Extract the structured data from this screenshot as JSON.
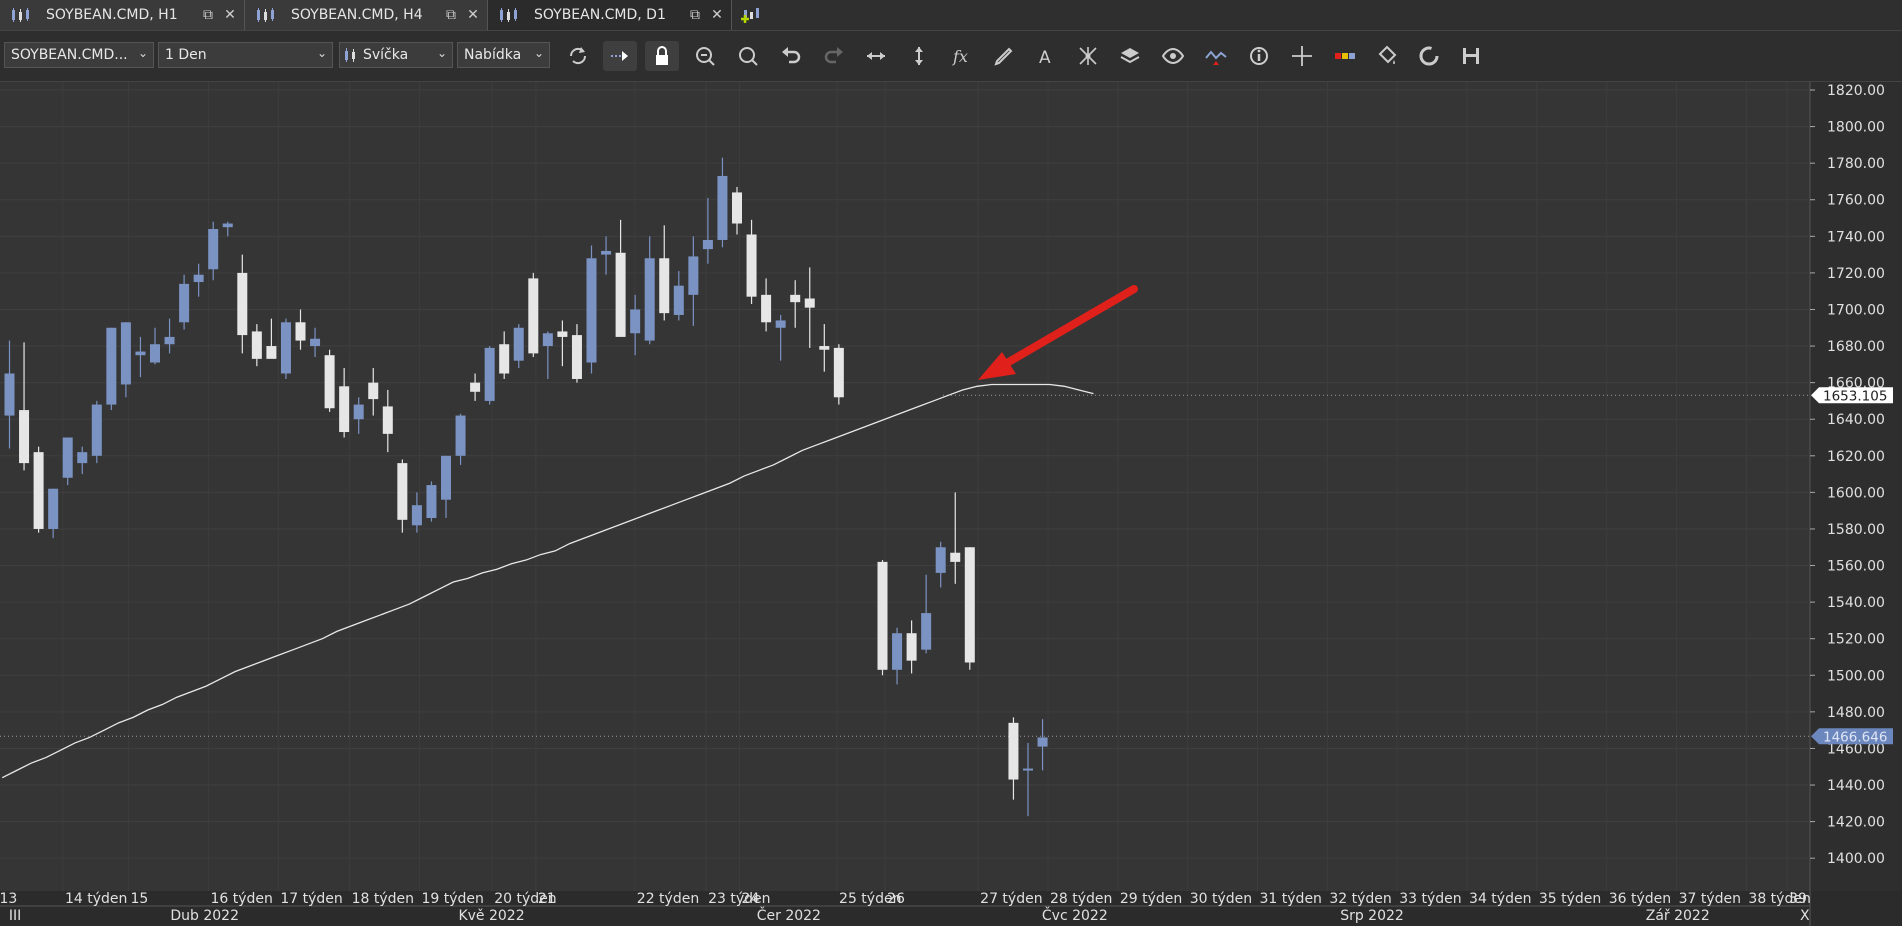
{
  "tabs": [
    {
      "label": "SOYBEAN.CMD, H1",
      "active": false
    },
    {
      "label": "SOYBEAN.CMD, H4",
      "active": false
    },
    {
      "label": "SOYBEAN.CMD, D1",
      "active": true
    }
  ],
  "toolbar": {
    "symbol": "SOYBEAN.CMD...",
    "timeframe": "1 Den",
    "chart_type": "Svíčka",
    "price_side": "Nabídka",
    "icons": [
      "refresh-icon",
      "shift-icon",
      "lock-icon",
      "zoom-in-icon",
      "zoom-out-icon",
      "undo-icon",
      "redo-icon",
      "horizontal-scale-icon",
      "vertical-scale-icon",
      "indicators-icon",
      "pencil-icon",
      "text-icon",
      "pattern-icon",
      "layers-icon",
      "eye-icon",
      "signals-icon",
      "info-icon",
      "crosshair-icon",
      "gauge-icon",
      "paint-icon",
      "reset-icon",
      "save-icon"
    ]
  },
  "colors": {
    "background": "#353535",
    "bull": "#7b93c3",
    "bear": "#e6e6e6",
    "ma_line": "#e8e8e8",
    "arrow": "#e0201b",
    "current_price_label": "#6c87bd"
  },
  "chart_data": {
    "type": "candlestick",
    "y_axis": {
      "min": 1390,
      "max": 1830,
      "ticks": [
        "1820.00",
        "1800.00",
        "1780.00",
        "1760.00",
        "1740.00",
        "1720.00",
        "1700.00",
        "1680.00",
        "1660.00",
        "1640.00",
        "1620.00",
        "1600.00",
        "1580.00",
        "1560.00",
        "1540.00",
        "1520.00",
        "1500.00",
        "1480.00",
        "1460.00",
        "1440.00",
        "1420.00",
        "1400.00"
      ],
      "tick_values": [
        1820,
        1800,
        1780,
        1760,
        1740,
        1720,
        1700,
        1680,
        1660,
        1640,
        1620,
        1600,
        1580,
        1560,
        1540,
        1520,
        1500,
        1480,
        1460,
        1440,
        1420,
        1400
      ]
    },
    "price_labels": [
      {
        "text": "1653.105",
        "value": 1653.105
      },
      {
        "text": "1466.646",
        "value": 1466.646
      }
    ],
    "week_labels": [
      {
        "text": "13",
        "bar": 0
      },
      {
        "text": "14 týden",
        "bar": 4.5
      },
      {
        "text": "15",
        "bar": 9
      },
      {
        "text": "16 týden",
        "bar": 14.5
      },
      {
        "text": "17 týden",
        "bar": 19.3
      },
      {
        "text": "18 týden",
        "bar": 24.2
      },
      {
        "text": "19 týden",
        "bar": 29
      },
      {
        "text": "20 týden",
        "bar": 34
      },
      {
        "text": "21",
        "bar": 37
      },
      {
        "text": "22 týden",
        "bar": 43.8
      },
      {
        "text": "23 týden",
        "bar": 48.7
      },
      {
        "text": "24",
        "bar": 51
      },
      {
        "text": "25 týden",
        "bar": 57.7
      },
      {
        "text": "26",
        "bar": 61
      },
      {
        "text": "27 týden",
        "bar": 67.4
      },
      {
        "text": "28 týden",
        "bar": 72.2
      },
      {
        "text": "29 týden",
        "bar": 77
      },
      {
        "text": "30 týden",
        "bar": 81.8
      },
      {
        "text": "31 týden",
        "bar": 86.6
      },
      {
        "text": "32 týden",
        "bar": 91.4
      },
      {
        "text": "33 týden",
        "bar": 96.2
      },
      {
        "text": "34 týden",
        "bar": 101
      },
      {
        "text": "35 týden",
        "bar": 105.8
      },
      {
        "text": "36 týden",
        "bar": 110.6
      },
      {
        "text": "37 týden",
        "bar": 115.4
      },
      {
        "text": "38 týden",
        "bar": 120.2
      },
      {
        "text": "39",
        "bar": 123
      }
    ],
    "month_labels": [
      {
        "text": "III",
        "bar": 0.3
      },
      {
        "text": "Dub 2022",
        "bar": 11.4
      },
      {
        "text": "Kvě 2022",
        "bar": 31.2
      },
      {
        "text": "Čer 2022",
        "bar": 51.7
      },
      {
        "text": "Čvc 2022",
        "bar": 71.3
      },
      {
        "text": "Srp 2022",
        "bar": 91.8
      },
      {
        "text": "Zář 2022",
        "bar": 112.8
      },
      {
        "text": "X",
        "bar": 123.4
      }
    ],
    "candles": [
      {
        "o": 1642,
        "h": 1683,
        "l": 1624,
        "c": 1665
      },
      {
        "o": 1645,
        "h": 1682,
        "l": 1612,
        "c": 1616
      },
      {
        "o": 1622,
        "h": 1625,
        "l": 1578,
        "c": 1580
      },
      {
        "o": 1580,
        "h": 1602,
        "l": 1575,
        "c": 1602
      },
      {
        "o": 1608,
        "h": 1630,
        "l": 1604,
        "c": 1630
      },
      {
        "o": 1616,
        "h": 1625,
        "l": 1610,
        "c": 1622
      },
      {
        "o": 1620,
        "h": 1650,
        "l": 1616,
        "c": 1648
      },
      {
        "o": 1648,
        "h": 1690,
        "l": 1645,
        "c": 1690
      },
      {
        "o": 1659,
        "h": 1693,
        "l": 1652,
        "c": 1693
      },
      {
        "o": 1675,
        "h": 1685,
        "l": 1663,
        "c": 1677
      },
      {
        "o": 1671,
        "h": 1690,
        "l": 1670,
        "c": 1681
      },
      {
        "o": 1681,
        "h": 1695,
        "l": 1676,
        "c": 1685
      },
      {
        "o": 1693,
        "h": 1719,
        "l": 1689,
        "c": 1714
      },
      {
        "o": 1715,
        "h": 1725,
        "l": 1707,
        "c": 1719
      },
      {
        "o": 1722,
        "h": 1748,
        "l": 1716,
        "c": 1744
      },
      {
        "o": 1745,
        "h": 1748,
        "l": 1740,
        "c": 1747
      },
      {
        "o": 1720,
        "h": 1730,
        "l": 1676,
        "c": 1686
      },
      {
        "o": 1688,
        "h": 1692,
        "l": 1669,
        "c": 1673
      },
      {
        "o": 1680,
        "h": 1695,
        "l": 1675,
        "c": 1673
      },
      {
        "o": 1665,
        "h": 1695,
        "l": 1662,
        "c": 1693
      },
      {
        "o": 1693,
        "h": 1700,
        "l": 1678,
        "c": 1683
      },
      {
        "o": 1680,
        "h": 1690,
        "l": 1674,
        "c": 1684
      },
      {
        "o": 1675,
        "h": 1678,
        "l": 1644,
        "c": 1646
      },
      {
        "o": 1658,
        "h": 1668,
        "l": 1630,
        "c": 1633
      },
      {
        "o": 1640,
        "h": 1652,
        "l": 1632,
        "c": 1648
      },
      {
        "o": 1660,
        "h": 1668,
        "l": 1642,
        "c": 1651
      },
      {
        "o": 1647,
        "h": 1656,
        "l": 1622,
        "c": 1632
      },
      {
        "o": 1616,
        "h": 1618,
        "l": 1578,
        "c": 1585
      },
      {
        "o": 1582,
        "h": 1600,
        "l": 1578,
        "c": 1593
      },
      {
        "o": 1586,
        "h": 1606,
        "l": 1584,
        "c": 1604
      },
      {
        "o": 1596,
        "h": 1620,
        "l": 1586,
        "c": 1620
      },
      {
        "o": 1620,
        "h": 1643,
        "l": 1615,
        "c": 1642
      },
      {
        "o": 1660,
        "h": 1665,
        "l": 1650,
        "c": 1655
      },
      {
        "o": 1650,
        "h": 1680,
        "l": 1648,
        "c": 1679
      },
      {
        "o": 1681,
        "h": 1688,
        "l": 1662,
        "c": 1665
      },
      {
        "o": 1672,
        "h": 1692,
        "l": 1668,
        "c": 1690
      },
      {
        "o": 1717,
        "h": 1720,
        "l": 1674,
        "c": 1676
      },
      {
        "o": 1680,
        "h": 1688,
        "l": 1662,
        "c": 1687
      },
      {
        "o": 1688,
        "h": 1694,
        "l": 1669,
        "c": 1685
      },
      {
        "o": 1686,
        "h": 1692,
        "l": 1660,
        "c": 1662
      },
      {
        "o": 1671,
        "h": 1735,
        "l": 1665,
        "c": 1728
      },
      {
        "o": 1730,
        "h": 1740,
        "l": 1719,
        "c": 1732
      },
      {
        "o": 1731,
        "h": 1749,
        "l": 1692,
        "c": 1685
      },
      {
        "o": 1687,
        "h": 1708,
        "l": 1675,
        "c": 1700
      },
      {
        "o": 1683,
        "h": 1740,
        "l": 1681,
        "c": 1728
      },
      {
        "o": 1728,
        "h": 1746,
        "l": 1694,
        "c": 1698
      },
      {
        "o": 1697,
        "h": 1721,
        "l": 1694,
        "c": 1713
      },
      {
        "o": 1708,
        "h": 1740,
        "l": 1691,
        "c": 1729
      },
      {
        "o": 1733,
        "h": 1761,
        "l": 1725,
        "c": 1738
      },
      {
        "o": 1738,
        "h": 1783,
        "l": 1734,
        "c": 1773
      },
      {
        "o": 1764,
        "h": 1767,
        "l": 1741,
        "c": 1747
      },
      {
        "o": 1741,
        "h": 1749,
        "l": 1703,
        "c": 1707
      },
      {
        "o": 1708,
        "h": 1717,
        "l": 1688,
        "c": 1693
      },
      {
        "o": 1690,
        "h": 1697,
        "l": 1672,
        "c": 1694
      },
      {
        "o": 1708,
        "h": 1716,
        "l": 1690,
        "c": 1704
      },
      {
        "o": 1706,
        "h": 1723,
        "l": 1679,
        "c": 1701
      },
      {
        "o": 1680,
        "h": 1692,
        "l": 1666,
        "c": 1678
      },
      {
        "o": 1679,
        "h": 1681,
        "l": 1648,
        "c": 1652
      },
      null,
      null,
      {
        "o": 1562,
        "h": 1563,
        "l": 1500,
        "c": 1503
      },
      {
        "o": 1503,
        "h": 1526,
        "l": 1495,
        "c": 1523
      },
      {
        "o": 1523,
        "h": 1530,
        "l": 1501,
        "c": 1508
      },
      {
        "o": 1514,
        "h": 1555,
        "l": 1512,
        "c": 1534
      },
      {
        "o": 1556,
        "h": 1573,
        "l": 1548,
        "c": 1570
      },
      {
        "o": 1567,
        "h": 1600,
        "l": 1550,
        "c": 1562
      },
      {
        "o": 1570,
        "h": 1570,
        "l": 1503,
        "c": 1507
      },
      null,
      null,
      {
        "o": 1474,
        "h": 1477,
        "l": 1432,
        "c": 1443
      },
      {
        "o": 1448,
        "h": 1463,
        "l": 1423,
        "c": 1449
      },
      {
        "o": 1461,
        "h": 1476,
        "l": 1448,
        "c": 1466
      }
    ],
    "moving_average": {
      "from_bar": -0.5,
      "values": [
        1444,
        1448,
        1452,
        1455,
        1459,
        1463,
        1466,
        1470,
        1474,
        1477,
        1481,
        1484,
        1488,
        1491,
        1494,
        1498,
        1502,
        1505,
        1508,
        1511,
        1514,
        1517,
        1520,
        1524,
        1527,
        1530,
        1533,
        1536,
        1539,
        1543,
        1547,
        1551,
        1553,
        1556,
        1558,
        1561,
        1563,
        1566,
        1568,
        1572,
        1575,
        1578,
        1581,
        1584,
        1587,
        1590,
        1593,
        1596,
        1599,
        1602,
        1605,
        1609,
        1612,
        1615,
        1619,
        1623,
        1626,
        1629,
        1632,
        1635,
        1638,
        1641,
        1644,
        1647,
        1650,
        1653,
        1656,
        1658,
        1659,
        1659,
        1659,
        1659,
        1659,
        1658,
        1656,
        1654
      ]
    },
    "annotation": "red arrow"
  }
}
